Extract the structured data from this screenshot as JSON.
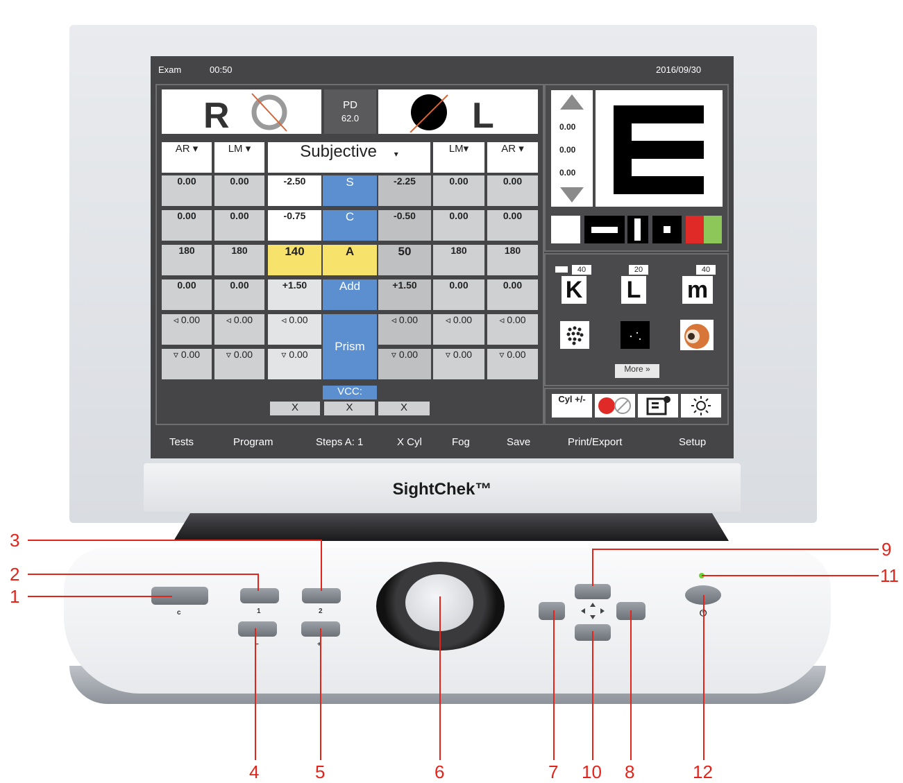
{
  "topbar": {
    "mode": "Exam",
    "timer": "00:50",
    "date": "2016/09/30"
  },
  "eyes": {
    "right": "R",
    "left": "L",
    "pd_label": "PD",
    "pd_value": "62.0"
  },
  "headers": {
    "ar_r": "AR ▾",
    "lm_r": "LM ▾",
    "subjective": "Subjective",
    "sub_arrow": "▾",
    "lm_l": "LM▾",
    "ar_l": "AR ▾"
  },
  "rows": {
    "s": {
      "label": "S",
      "ar_r": "0.00",
      "lm_r": "0.00",
      "r": "-2.50",
      "l": "-2.25",
      "lm_l": "0.00",
      "ar_l": "0.00"
    },
    "c": {
      "label": "C",
      "ar_r": "0.00",
      "lm_r": "0.00",
      "r": "-0.75",
      "l": "-0.50",
      "lm_l": "0.00",
      "ar_l": "0.00"
    },
    "a": {
      "label": "A",
      "ar_r": "180",
      "lm_r": "180",
      "r": "140",
      "l": "50",
      "lm_l": "180",
      "ar_l": "180"
    },
    "add": {
      "label": "Add",
      "ar_r": "0.00",
      "lm_r": "0.00",
      "r": "+1.50",
      "l": "+1.50",
      "lm_l": "0.00",
      "ar_l": "0.00"
    },
    "prism_h": {
      "ar_r": "◃ 0.00",
      "lm_r": "◃ 0.00",
      "r": "◃ 0.00",
      "l": "◃ 0.00",
      "lm_l": "◃ 0.00",
      "ar_l": "◃ 0.00"
    },
    "prism_v": {
      "ar_r": "▿ 0.00",
      "lm_r": "▿ 0.00",
      "r": "▿ 0.00",
      "l": "▿ 0.00",
      "lm_l": "▿ 0.00",
      "ar_l": "▿ 0.00"
    },
    "prism_label": "Prism"
  },
  "vcc": {
    "label": "VCC:",
    "x1": "X",
    "x2": "X",
    "x3": "X"
  },
  "chart": {
    "v1": "0.00",
    "v2": "0.00",
    "v3": "0.00",
    "letter": "E"
  },
  "tests": {
    "k_num": "40",
    "l_num": "20",
    "m_num": "40",
    "k": "K",
    "l": "L",
    "m": "m",
    "more": "More »"
  },
  "tools": {
    "cyl": "Cyl +/-"
  },
  "menu": [
    "Tests",
    "Program",
    "Steps A: 1",
    "X Cyl",
    "Fog",
    "Save",
    "Print/Export",
    "Setup"
  ],
  "brand": "SightChek™",
  "keys": {
    "clear": "c",
    "one": "1",
    "two": "2",
    "minus": "−",
    "plus": "+",
    "power": "⏻"
  },
  "callouts": [
    "1",
    "2",
    "3",
    "4",
    "5",
    "6",
    "7",
    "8",
    "9",
    "10",
    "11",
    "12"
  ],
  "colors": {
    "blue": "#5b8fd0",
    "yellow": "#f7e36b",
    "screen": "#454547",
    "callout": "#e3241b",
    "led": "#6fd13a"
  }
}
